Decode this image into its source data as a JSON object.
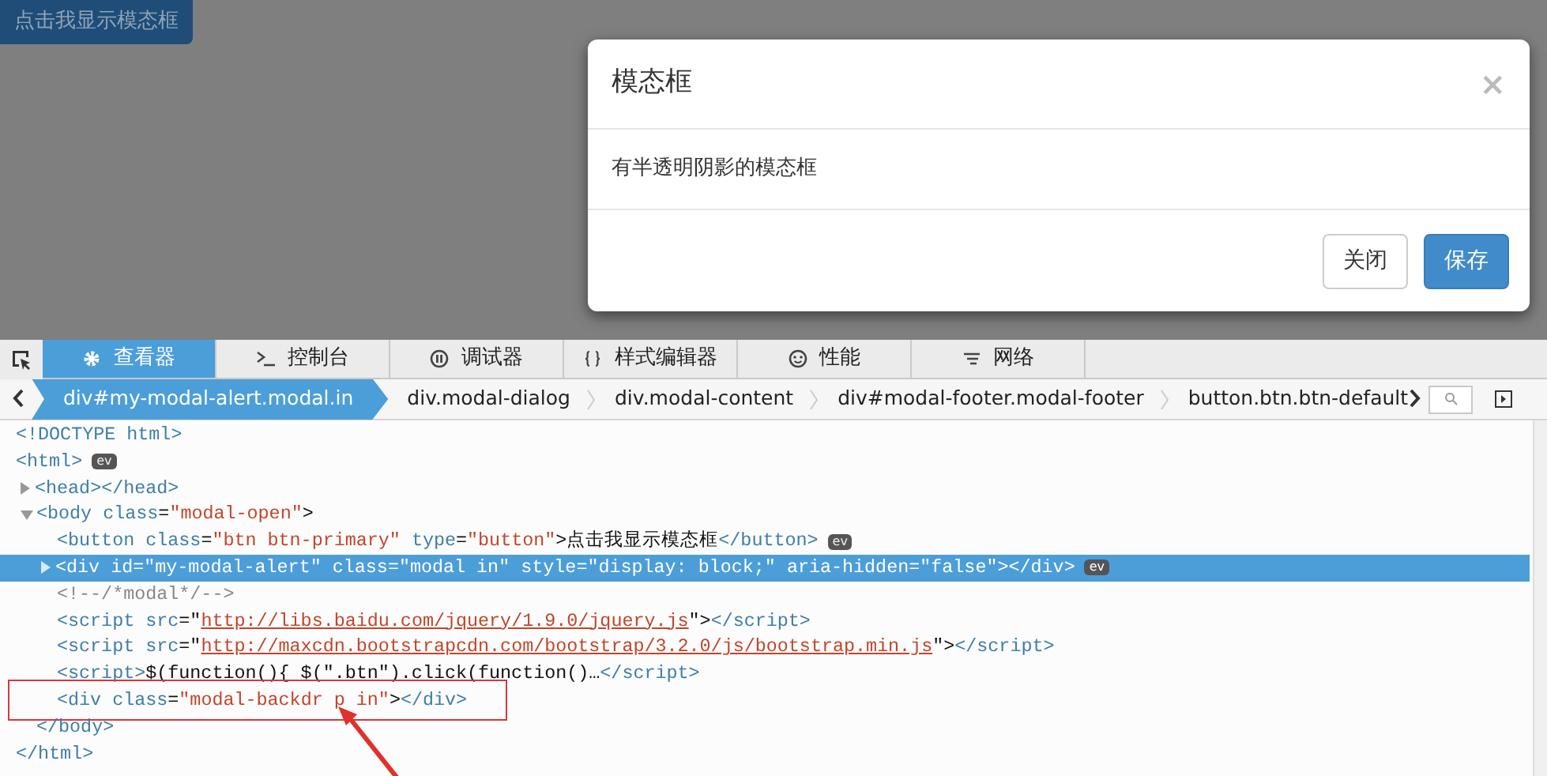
{
  "page": {
    "button": "点击我显示模态框"
  },
  "modal": {
    "title": "模态框",
    "close": "×",
    "body": "有半透明阴影的模态框",
    "buttons": [
      {
        "label": "关闭",
        "kind": "default"
      },
      {
        "label": "保存",
        "kind": "primary"
      }
    ]
  },
  "devtools": {
    "tabs": [
      {
        "label": "查看器",
        "selected": true
      },
      {
        "label": "控制台",
        "selected": false
      },
      {
        "label": "调试器",
        "selected": false
      },
      {
        "label": "样式编辑器",
        "selected": false
      },
      {
        "label": "性能",
        "selected": false
      },
      {
        "label": "网络",
        "selected": false
      }
    ],
    "breadcrumbs": [
      {
        "label": "div#my-modal-alert.modal.in",
        "selected": true
      },
      {
        "label": "div.modal-dialog",
        "selected": false
      },
      {
        "label": "div.modal-content",
        "selected": false
      },
      {
        "label": "div#modal-footer.modal-footer",
        "selected": false
      },
      {
        "label": "button.btn.btn-default",
        "selected": false
      }
    ],
    "tree": [
      {
        "tokens": [
          {
            "kind": "tag",
            "text": "<!DOCTYPE html>"
          }
        ]
      },
      {
        "tokens": [
          {
            "kind": "tag",
            "text": "<html>"
          }
        ],
        "badge": "ev",
        "closing": [
          {
            "kind": "tag",
            "text": "</html>"
          }
        ],
        "children": [
          {
            "tokens": [
              {
                "kind": "tag",
                "text": "<head></head>"
              }
            ],
            "expanded": false
          },
          {
            "tokens": [
              {
                "kind": "tag",
                "text": "<body "
              },
              {
                "kind": "attr",
                "text": "class"
              },
              {
                "kind": "text",
                "text": "="
              },
              {
                "kind": "value",
                "text": "\"modal-open\""
              },
              {
                "kind": "text",
                "text": ">"
              }
            ],
            "expanded": true,
            "closing": [
              {
                "kind": "tag",
                "text": "</body>"
              }
            ],
            "children": [
              {
                "tokens": [
                  {
                    "kind": "tag",
                    "text": "<button "
                  },
                  {
                    "kind": "attr",
                    "text": "class"
                  },
                  {
                    "kind": "text",
                    "text": "="
                  },
                  {
                    "kind": "value",
                    "text": "\"btn btn-primary\""
                  },
                  {
                    "kind": "attr",
                    "text": " type"
                  },
                  {
                    "kind": "text",
                    "text": "="
                  },
                  {
                    "kind": "value",
                    "text": "\"button\""
                  },
                  {
                    "kind": "text",
                    "text": ">点击我显示模态框"
                  },
                  {
                    "kind": "tag",
                    "text": "</button>"
                  }
                ],
                "badge": "ev"
              },
              {
                "tokens": [
                  {
                    "kind": "tag",
                    "text": "<div "
                  },
                  {
                    "kind": "attr",
                    "text": "id"
                  },
                  {
                    "kind": "text",
                    "text": "="
                  },
                  {
                    "kind": "value",
                    "text": "\"my-modal-alert\""
                  },
                  {
                    "kind": "attr",
                    "text": " class"
                  },
                  {
                    "kind": "text",
                    "text": "="
                  },
                  {
                    "kind": "value",
                    "text": "\"modal in\""
                  },
                  {
                    "kind": "attr",
                    "text": " style"
                  },
                  {
                    "kind": "text",
                    "text": "="
                  },
                  {
                    "kind": "value",
                    "text": "\"display: block;\""
                  },
                  {
                    "kind": "attr",
                    "text": " aria-hidden"
                  },
                  {
                    "kind": "text",
                    "text": "="
                  },
                  {
                    "kind": "value",
                    "text": "\"false\""
                  },
                  {
                    "kind": "text",
                    "text": ">"
                  },
                  {
                    "kind": "tag",
                    "text": "</div>"
                  }
                ],
                "expanded": false,
                "selected": true,
                "badge": "ev"
              },
              {
                "tokens": [
                  {
                    "kind": "comment",
                    "text": "<!--/*modal*/-->"
                  }
                ]
              },
              {
                "tokens": [
                  {
                    "kind": "tag",
                    "text": "<script "
                  },
                  {
                    "kind": "attr",
                    "text": "src"
                  },
                  {
                    "kind": "text",
                    "text": "=\""
                  },
                  {
                    "kind": "link",
                    "text": "http://libs.baidu.com/jquery/1.9.0/jquery.js"
                  },
                  {
                    "kind": "text",
                    "text": "\">"
                  },
                  {
                    "kind": "tag",
                    "text": "</script>"
                  }
                ]
              },
              {
                "tokens": [
                  {
                    "kind": "tag",
                    "text": "<script "
                  },
                  {
                    "kind": "attr",
                    "text": "src"
                  },
                  {
                    "kind": "text",
                    "text": "=\""
                  },
                  {
                    "kind": "link",
                    "text": "http://maxcdn.bootstrapcdn.com/bootstrap/3.2.0/js/bootstrap.min.js"
                  },
                  {
                    "kind": "text",
                    "text": "\">"
                  },
                  {
                    "kind": "tag",
                    "text": "</script>"
                  }
                ]
              },
              {
                "tokens": [
                  {
                    "kind": "tag",
                    "text": "<script>"
                  },
                  {
                    "kind": "text",
                    "text": "$(function(){ $(\".btn\").click(function()…"
                  },
                  {
                    "kind": "tag",
                    "text": "</script>"
                  }
                ]
              },
              {
                "tokens": [
                  {
                    "kind": "tag",
                    "text": "<div "
                  },
                  {
                    "kind": "attr",
                    "text": "class"
                  },
                  {
                    "kind": "text",
                    "text": "="
                  },
                  {
                    "kind": "value",
                    "text": "\"modal-backdr"
                  },
                  {
                    "kind": "value",
                    "text": "p in\"",
                    "gap": true
                  },
                  {
                    "kind": "text",
                    "text": ">"
                  },
                  {
                    "kind": "tag",
                    "text": "</div>"
                  }
                ],
                "annotated": true
              }
            ]
          }
        ]
      }
    ]
  }
}
